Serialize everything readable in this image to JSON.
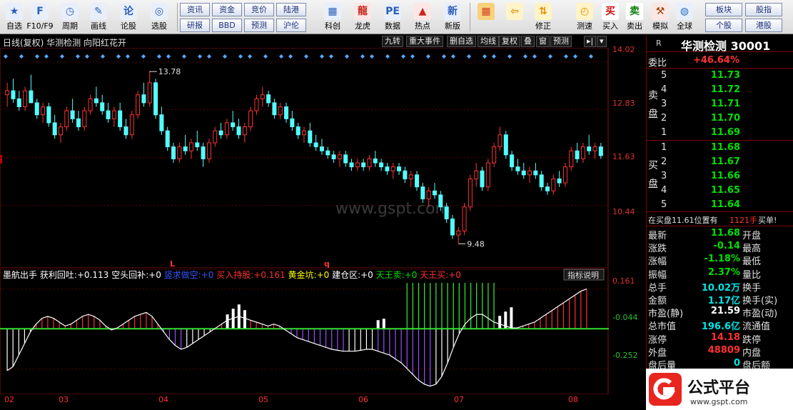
{
  "toolbar": {
    "items": [
      {
        "label": "自选",
        "icon": "star-icon"
      },
      {
        "label": "F10/F9",
        "icon": "f10-icon"
      },
      {
        "label": "周期",
        "icon": "clock-icon"
      },
      {
        "label": "画线",
        "icon": "pen-icon"
      },
      {
        "label": "论股",
        "icon": "discuss-icon"
      },
      {
        "label": "选股",
        "icon": "select-icon"
      }
    ],
    "small_buttons": [
      [
        "资讯",
        "资金",
        "竞价",
        "陆港"
      ],
      [
        "研报",
        "BBD",
        "预测",
        "沪伦"
      ]
    ],
    "items2": [
      {
        "label": "科创",
        "icon": "chart-icon"
      },
      {
        "label": "龙虎",
        "icon": "dragon-icon"
      },
      {
        "label": "数据",
        "icon": "pe-icon"
      },
      {
        "label": "热点",
        "icon": "hot-icon"
      },
      {
        "label": "新版",
        "icon": "new-icon"
      }
    ],
    "items3": [
      {
        "label": "",
        "icon": "grid-icon"
      },
      {
        "label": "",
        "icon": "back-arrow-icon"
      },
      {
        "label": "修正",
        "icon": "updown-icon"
      },
      {
        "label": "测速",
        "icon": "speed-icon"
      },
      {
        "label": "买入",
        "icon": "buy-icon",
        "glyph": "买"
      },
      {
        "label": "卖出",
        "icon": "sell-icon",
        "glyph": "卖"
      },
      {
        "label": "模拟",
        "icon": "hammer-icon"
      },
      {
        "label": "全球",
        "icon": "globe-icon"
      }
    ],
    "right_buttons": [
      [
        "板块",
        "股指"
      ],
      [
        "个股",
        "港股"
      ]
    ]
  },
  "title_bar": {
    "title": "日线(复权)  华测检测 向阳红花开",
    "tabs": [
      "九转",
      "重大事件",
      "删自选",
      "均线",
      "复权",
      "叠",
      "窗",
      "预测"
    ]
  },
  "price_axis": [
    "14.02",
    "12.83",
    "11.63",
    "10.44"
  ],
  "annotations": {
    "high": "13.78",
    "low": "9.48",
    "mark_l": "L",
    "mark_q": "q"
  },
  "watermark": "www.gspt.com",
  "indicator": {
    "name": "墨航出手",
    "items": [
      {
        "label": "获利回吐:",
        "value": "+0.113",
        "color": "#ffffff"
      },
      {
        "label": "空头回补:",
        "value": "+0",
        "color": "#ffffff"
      },
      {
        "label": "竖求做空:",
        "value": "+0",
        "color": "#3355ff"
      },
      {
        "label": "买入持股:",
        "value": "+0.161",
        "color": "#ff3030"
      },
      {
        "label": "黄金坑:",
        "value": "+0",
        "color": "#ffff00"
      },
      {
        "label": "建仓区:",
        "value": "+0",
        "color": "#ffffff"
      },
      {
        "label": "天王卖:",
        "value": "+0",
        "color": "#00e000"
      },
      {
        "label": "天王买:",
        "value": "+0",
        "color": "#ff3030"
      }
    ],
    "help_button": "指标说明",
    "axis": [
      "0.161",
      "-0.044",
      "-0.252"
    ]
  },
  "dates": [
    "02",
    "03",
    "04",
    "05",
    "06",
    "07",
    "08"
  ],
  "stock": {
    "marker": "R",
    "name": "华测检测 30001"
  },
  "quote": {
    "weibi_label": "委比",
    "weibi": "+46.64%",
    "sell_side": "卖盘",
    "buy_side": "买盘",
    "sell": [
      [
        "5",
        "11.73"
      ],
      [
        "4",
        "11.72"
      ],
      [
        "3",
        "11.71"
      ],
      [
        "2",
        "11.70"
      ],
      [
        "1",
        "11.69"
      ]
    ],
    "buy": [
      [
        "1",
        "11.68"
      ],
      [
        "2",
        "11.67"
      ],
      [
        "3",
        "11.66"
      ],
      [
        "4",
        "11.65"
      ],
      [
        "5",
        "11.64"
      ]
    ],
    "notice": "在买盘11.61位置有",
    "notice_qty": "1121手",
    "notice_action": "买单!",
    "rows": [
      {
        "l": "最新",
        "v": "11.68",
        "c": "green",
        "r": "开盘"
      },
      {
        "l": "涨跌",
        "v": "-0.14",
        "c": "green",
        "r": "最高"
      },
      {
        "l": "涨幅",
        "v": "-1.18%",
        "c": "green",
        "r": "最低"
      },
      {
        "l": "振幅",
        "v": "2.37%",
        "c": "green",
        "r": "量比"
      },
      {
        "l": "总手",
        "v": "10.02万",
        "c": "cyan",
        "r": "换手"
      },
      {
        "l": "金额",
        "v": "1.17亿",
        "c": "cyan",
        "r": "换手(实)"
      },
      {
        "l": "市盈(静)",
        "v": "21.59",
        "c": "white",
        "r": "市盈(动)"
      },
      {
        "l": "总市值",
        "v": "196.6亿",
        "c": "cyan",
        "r": "流通值"
      },
      {
        "l": "涨停",
        "v": "14.18",
        "c": "red",
        "r": "跌停"
      },
      {
        "l": "外盘",
        "v": "48809",
        "c": "red",
        "r": "内盘"
      },
      {
        "l": "盘后量",
        "v": "0",
        "c": "cyan",
        "r": "盘后额"
      }
    ]
  },
  "logo": {
    "text": "公式平台",
    "url_text": "www.gspt.com"
  },
  "chart_data": {
    "type": "candlestick",
    "series": [
      {
        "values": [
          [
            13.2,
            13.5,
            12.9,
            13.3
          ],
          [
            13.3,
            13.6,
            13.0,
            13.1
          ],
          [
            13.1,
            13.3,
            12.8,
            12.9
          ],
          [
            12.9,
            13.4,
            12.8,
            13.3
          ],
          [
            13.3,
            13.7,
            13.0,
            13.0
          ],
          [
            13.0,
            13.1,
            12.6,
            12.7
          ],
          [
            12.7,
            13.0,
            12.5,
            12.9
          ],
          [
            12.9,
            13.0,
            12.4,
            12.5
          ],
          [
            12.5,
            12.7,
            12.1,
            12.2
          ],
          [
            12.2,
            12.5,
            12.0,
            12.4
          ],
          [
            12.4,
            12.9,
            12.3,
            12.8
          ],
          [
            12.8,
            13.1,
            12.5,
            12.6
          ],
          [
            12.6,
            12.8,
            12.3,
            12.4
          ],
          [
            12.4,
            12.9,
            12.3,
            12.8
          ],
          [
            12.8,
            13.2,
            12.7,
            13.1
          ],
          [
            13.1,
            13.4,
            12.9,
            13.0
          ],
          [
            13.0,
            13.2,
            12.7,
            12.8
          ],
          [
            12.8,
            13.0,
            12.5,
            12.6
          ],
          [
            12.6,
            12.9,
            12.4,
            12.8
          ],
          [
            12.8,
            13.0,
            12.3,
            12.4
          ],
          [
            12.4,
            12.6,
            12.1,
            12.2
          ],
          [
            12.2,
            12.8,
            12.1,
            12.7
          ],
          [
            12.7,
            13.3,
            12.6,
            13.2
          ],
          [
            13.2,
            13.5,
            12.9,
            13.0
          ],
          [
            13.0,
            13.8,
            12.9,
            13.5
          ],
          [
            13.5,
            13.6,
            12.6,
            12.7
          ],
          [
            12.7,
            12.9,
            12.2,
            12.3
          ],
          [
            12.3,
            12.4,
            11.8,
            11.9
          ],
          [
            11.9,
            12.0,
            11.5,
            11.6
          ],
          [
            11.6,
            12.0,
            11.5,
            11.9
          ],
          [
            11.9,
            12.2,
            11.7,
            11.8
          ],
          [
            11.8,
            12.1,
            11.6,
            12.0
          ],
          [
            12.0,
            12.3,
            11.8,
            11.9
          ],
          [
            11.9,
            12.0,
            11.4,
            11.6
          ],
          [
            11.6,
            12.1,
            11.5,
            12.0
          ],
          [
            12.0,
            12.4,
            11.9,
            12.3
          ],
          [
            12.3,
            12.5,
            12.1,
            12.2
          ],
          [
            12.2,
            12.6,
            12.1,
            12.5
          ],
          [
            12.5,
            12.8,
            12.3,
            12.4
          ],
          [
            12.4,
            12.6,
            12.1,
            12.2
          ],
          [
            12.2,
            12.5,
            12.0,
            12.4
          ],
          [
            12.4,
            12.9,
            12.3,
            12.8
          ],
          [
            12.8,
            13.2,
            12.7,
            13.1
          ],
          [
            13.1,
            13.4,
            12.9,
            13.2
          ],
          [
            13.2,
            13.3,
            12.9,
            13.0
          ],
          [
            13.0,
            13.1,
            12.6,
            12.7
          ],
          [
            12.7,
            13.0,
            12.6,
            12.9
          ],
          [
            12.9,
            13.0,
            12.5,
            12.6
          ],
          [
            12.6,
            12.8,
            12.3,
            12.4
          ],
          [
            12.4,
            12.5,
            12.1,
            12.2
          ],
          [
            12.2,
            12.4,
            12.0,
            12.3
          ],
          [
            12.3,
            12.5,
            11.9,
            12.0
          ],
          [
            12.0,
            12.2,
            11.8,
            11.9
          ],
          [
            11.9,
            12.1,
            11.7,
            11.8
          ],
          [
            11.8,
            11.9,
            11.6,
            11.7
          ],
          [
            11.7,
            11.8,
            11.5,
            11.6
          ],
          [
            11.6,
            11.8,
            11.4,
            11.7
          ],
          [
            11.7,
            11.8,
            11.4,
            11.5
          ],
          [
            11.5,
            11.6,
            11.3,
            11.4
          ],
          [
            11.4,
            11.6,
            11.3,
            11.5
          ],
          [
            11.5,
            11.6,
            11.3,
            11.4
          ],
          [
            11.4,
            11.7,
            11.3,
            11.6
          ],
          [
            11.6,
            11.8,
            11.4,
            11.5
          ],
          [
            11.5,
            11.6,
            11.3,
            11.4
          ],
          [
            11.4,
            11.5,
            11.2,
            11.3
          ],
          [
            11.3,
            11.5,
            11.1,
            11.4
          ],
          [
            11.4,
            11.5,
            11.2,
            11.3
          ],
          [
            11.3,
            11.4,
            11.0,
            11.1
          ],
          [
            11.1,
            11.3,
            10.9,
            11.2
          ],
          [
            11.2,
            11.3,
            10.8,
            10.9
          ],
          [
            10.9,
            11.0,
            10.5,
            10.6
          ],
          [
            10.6,
            10.9,
            10.4,
            10.8
          ],
          [
            10.8,
            11.0,
            10.6,
            10.7
          ],
          [
            10.7,
            10.8,
            10.3,
            10.4
          ],
          [
            10.4,
            10.5,
            10.0,
            10.1
          ],
          [
            10.1,
            10.2,
            9.6,
            9.7
          ],
          [
            9.7,
            9.9,
            9.48,
            9.8
          ],
          [
            9.8,
            10.5,
            9.7,
            10.4
          ],
          [
            10.4,
            11.2,
            10.3,
            11.1
          ],
          [
            11.1,
            11.5,
            10.9,
            11.3
          ],
          [
            11.3,
            11.4,
            10.8,
            10.9
          ],
          [
            10.9,
            11.6,
            10.8,
            11.5
          ],
          [
            11.5,
            12.0,
            11.4,
            11.9
          ],
          [
            11.9,
            12.4,
            11.8,
            12.2
          ],
          [
            12.2,
            12.3,
            11.6,
            11.7
          ],
          [
            11.7,
            11.8,
            11.3,
            11.4
          ],
          [
            11.4,
            11.6,
            11.2,
            11.3
          ],
          [
            11.3,
            11.5,
            11.1,
            11.2
          ],
          [
            11.2,
            11.4,
            11.0,
            11.3
          ],
          [
            11.3,
            11.5,
            11.1,
            11.2
          ],
          [
            11.2,
            11.3,
            10.8,
            10.9
          ],
          [
            10.9,
            11.0,
            10.7,
            10.8
          ],
          [
            10.8,
            11.2,
            10.7,
            11.1
          ],
          [
            11.1,
            11.3,
            10.9,
            11.0
          ],
          [
            11.0,
            11.5,
            10.9,
            11.4
          ],
          [
            11.4,
            11.9,
            11.3,
            11.8
          ],
          [
            11.8,
            12.0,
            11.5,
            11.6
          ],
          [
            11.6,
            12.0,
            11.5,
            11.9
          ],
          [
            11.9,
            12.2,
            11.7,
            11.8
          ],
          [
            11.8,
            12.0,
            11.6,
            11.9
          ],
          [
            11.9,
            12.0,
            11.6,
            11.68
          ]
        ]
      }
    ],
    "ylim": [
      9.2,
      14.3
    ],
    "indicator_values": [
      -0.26,
      -0.24,
      -0.18,
      -0.12,
      -0.06,
      -0.02,
      0.01,
      0.02,
      0.01,
      -0.01,
      -0.03,
      -0.02,
      0.0,
      0.02,
      0.03,
      0.02,
      0.0,
      -0.03,
      -0.05,
      -0.04,
      -0.02,
      0.0,
      0.02,
      0.03,
      0.04,
      0.02,
      -0.02,
      -0.06,
      -0.1,
      -0.13,
      -0.15,
      -0.14,
      -0.12,
      -0.1,
      -0.08,
      -0.06,
      -0.04,
      -0.02,
      0.0,
      0.01,
      0.02,
      0.01,
      0.0,
      -0.01,
      -0.02,
      -0.03,
      -0.02,
      -0.03,
      -0.05,
      -0.07,
      -0.09,
      -0.1,
      -0.11,
      -0.12,
      -0.13,
      -0.14,
      -0.15,
      -0.155,
      -0.16,
      -0.16,
      -0.16,
      -0.155,
      -0.15,
      -0.15,
      -0.16,
      -0.17,
      -0.18,
      -0.2,
      -0.22,
      -0.25,
      -0.28,
      -0.31,
      -0.33,
      -0.34,
      -0.33,
      -0.29,
      -0.22,
      -0.14,
      -0.07,
      -0.02,
      0.01,
      0.03,
      0.03,
      0.01,
      -0.01,
      -0.02,
      -0.03,
      -0.04,
      -0.04,
      -0.03,
      -0.02,
      -0.01,
      0.01,
      0.03,
      0.05,
      0.07,
      0.09,
      0.11,
      0.13,
      0.15,
      0.161
    ],
    "indicator_ylim": [
      -0.36,
      0.2
    ]
  }
}
